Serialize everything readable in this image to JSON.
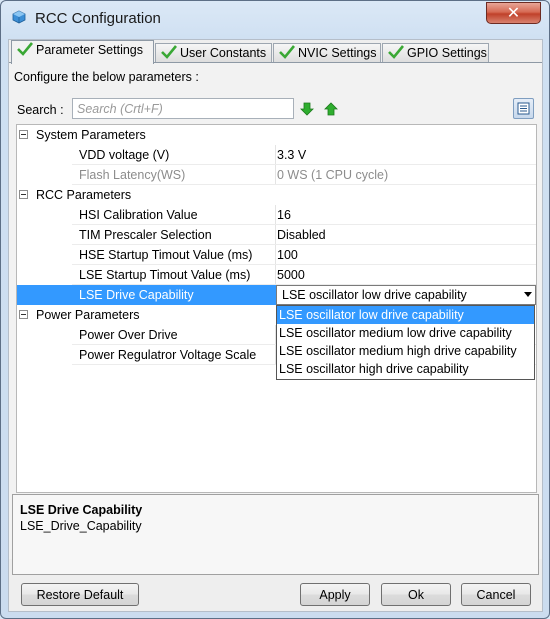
{
  "window": {
    "title": "RCC Configuration",
    "close_glyph": "✕"
  },
  "tabs": [
    {
      "label": "Parameter Settings",
      "active": true
    },
    {
      "label": "User Constants",
      "active": false
    },
    {
      "label": "NVIC Settings",
      "active": false
    },
    {
      "label": "GPIO Settings",
      "active": false
    }
  ],
  "panel": {
    "instruction": "Configure the below parameters :",
    "search_label": "Search :",
    "search_placeholder": "Search (Crtl+F)",
    "search_value": ""
  },
  "tree": {
    "groups": [
      {
        "label": "System Parameters",
        "rows": [
          {
            "key": "VDD voltage (V)",
            "value": "3.3 V",
            "disabled": false
          },
          {
            "key": "Flash Latency(WS)",
            "value": "0 WS (1 CPU cycle)",
            "disabled": true
          }
        ]
      },
      {
        "label": "RCC Parameters",
        "rows": [
          {
            "key": "HSI Calibration Value",
            "value": "16"
          },
          {
            "key": "TIM Prescaler Selection",
            "value": "Disabled"
          },
          {
            "key": "HSE Startup Timout Value (ms)",
            "value": "100"
          },
          {
            "key": "LSE Startup Timout Value (ms)",
            "value": "5000"
          },
          {
            "key": "LSE Drive Capability",
            "value": "LSE oscillator low drive capability",
            "selected": true
          }
        ]
      },
      {
        "label": "Power Parameters",
        "rows": [
          {
            "key": "Power Over Drive",
            "value": ""
          },
          {
            "key": "Power Regulatror Voltage Scale",
            "value": ""
          }
        ]
      }
    ]
  },
  "dropdown": {
    "options": [
      "LSE oscillator low drive capability",
      "LSE oscillator medium low drive capability",
      "LSE oscillator medium high drive capability",
      "LSE oscillator high drive capability"
    ],
    "selected_index": 0
  },
  "description": {
    "title": "LSE Drive Capability",
    "text": "LSE_Drive_Capability"
  },
  "buttons": {
    "restore": "Restore Default",
    "apply": "Apply",
    "ok": "Ok",
    "cancel": "Cancel"
  },
  "colors": {
    "selection": "#3399ff",
    "check": "#3aa835",
    "arrow_green": "#2fae2f"
  }
}
